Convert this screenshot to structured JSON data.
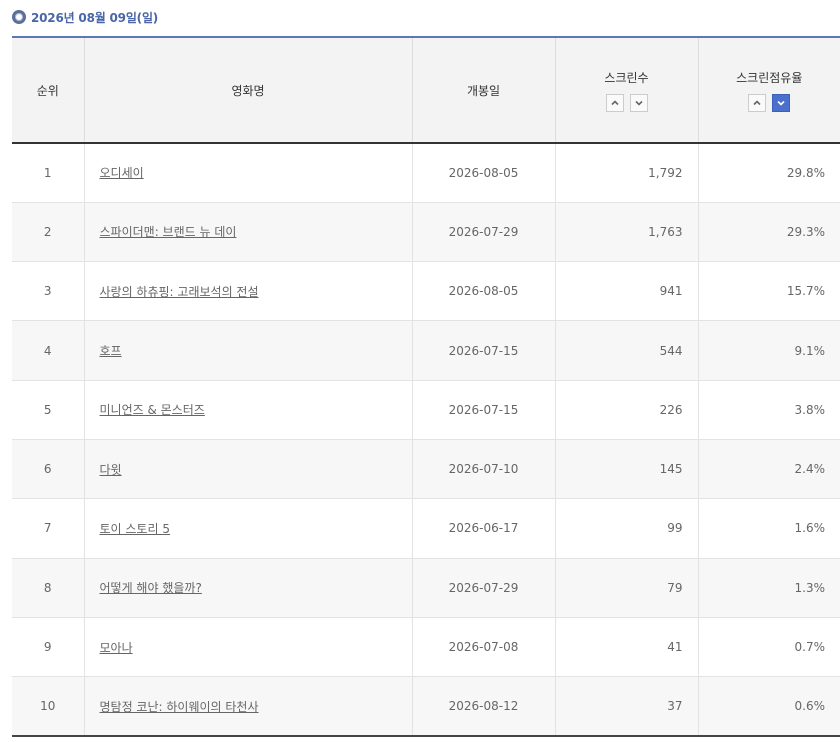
{
  "date_header": "2026년 08월 09일(일)",
  "columns": {
    "rank": "순위",
    "title": "영화명",
    "open_date": "개봉일",
    "screens": "스크린수",
    "share": "스크린점유율"
  },
  "rows": [
    {
      "rank": "1",
      "title": "오디세이",
      "open_date": "2026-08-05",
      "screens": "1,792",
      "share": "29.8%"
    },
    {
      "rank": "2",
      "title": "스파이더맨: 브랜드 뉴 데이",
      "open_date": "2026-07-29",
      "screens": "1,763",
      "share": "29.3%"
    },
    {
      "rank": "3",
      "title": "사랑의 하츄핑: 고래보석의 전설",
      "open_date": "2026-08-05",
      "screens": "941",
      "share": "15.7%"
    },
    {
      "rank": "4",
      "title": "호프",
      "open_date": "2026-07-15",
      "screens": "544",
      "share": "9.1%"
    },
    {
      "rank": "5",
      "title": "미니언즈 & 몬스터즈",
      "open_date": "2026-07-15",
      "screens": "226",
      "share": "3.8%"
    },
    {
      "rank": "6",
      "title": "다윗",
      "open_date": "2026-07-10",
      "screens": "145",
      "share": "2.4%"
    },
    {
      "rank": "7",
      "title": "토이 스토리 5",
      "open_date": "2026-06-17",
      "screens": "99",
      "share": "1.6%"
    },
    {
      "rank": "8",
      "title": "어떻게 해야 했을까?",
      "open_date": "2026-07-29",
      "screens": "79",
      "share": "1.3%"
    },
    {
      "rank": "9",
      "title": "모아나",
      "open_date": "2026-07-08",
      "screens": "41",
      "share": "0.7%"
    },
    {
      "rank": "10",
      "title": "명탐정 코난: 하이웨이의 타천사",
      "open_date": "2026-08-12",
      "screens": "37",
      "share": "0.6%"
    }
  ],
  "sort_state": {
    "screens": "none",
    "share": "desc"
  },
  "colors": {
    "accent": "#4a6fcc",
    "header_border": "#5b78b5"
  }
}
